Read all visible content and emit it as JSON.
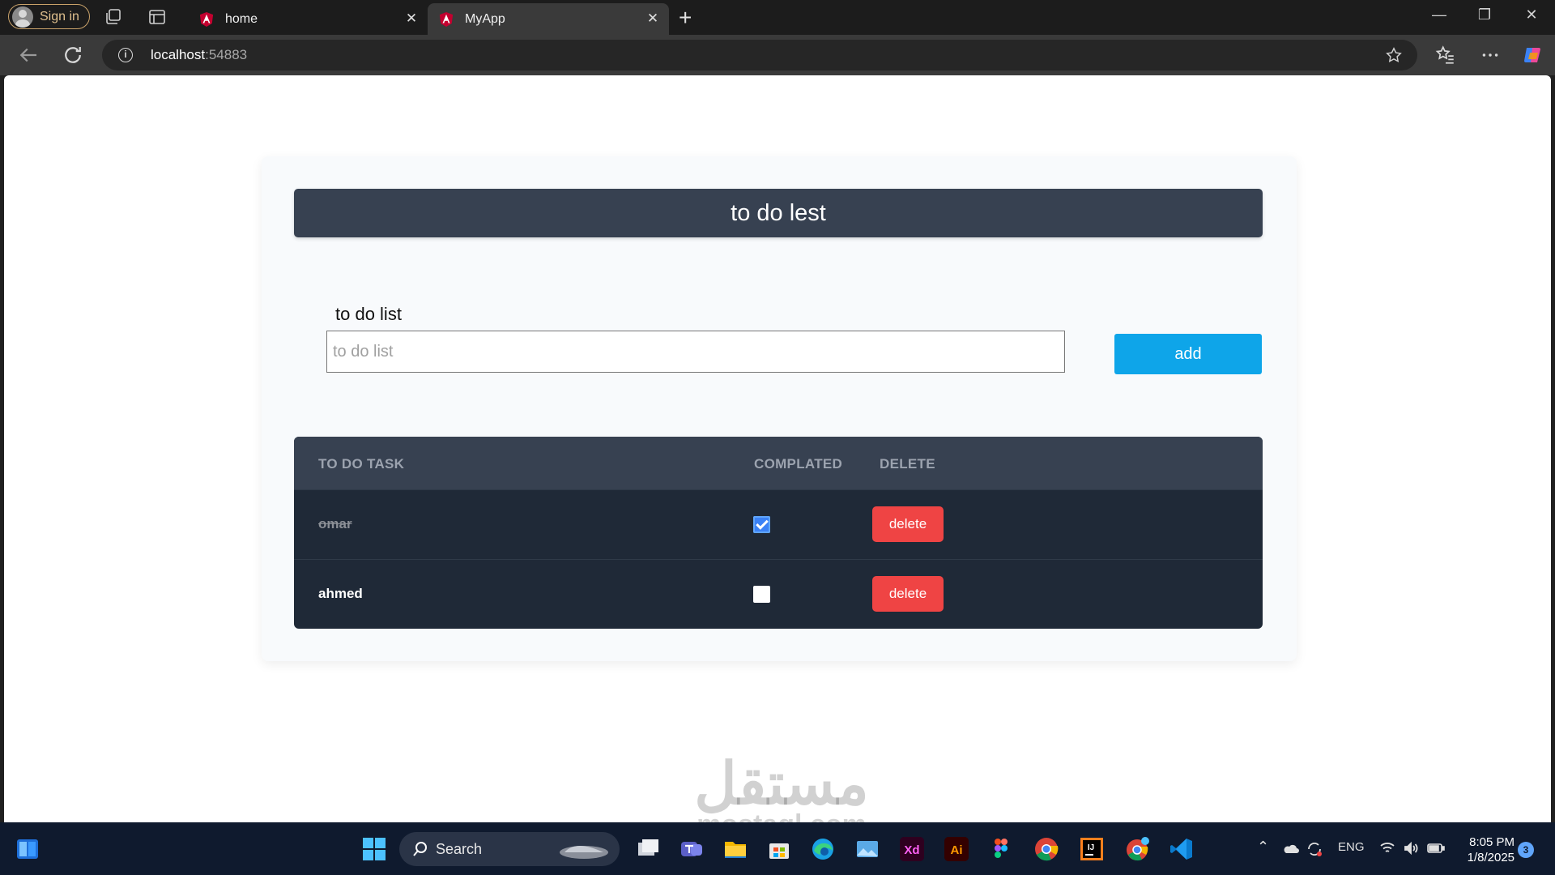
{
  "browser": {
    "signin_label": "Sign in",
    "tabs": [
      {
        "label": "home",
        "active": false
      },
      {
        "label": "MyApp",
        "active": true
      }
    ],
    "url_host": "localhost",
    "url_port": ":54883"
  },
  "app": {
    "header_title": "to do lest",
    "input_label": "to do list",
    "input_placeholder": "to do list",
    "input_value": "",
    "add_label": "add",
    "table": {
      "columns": [
        "TO DO TASK",
        "COMPLATED",
        "DELETE"
      ],
      "rows": [
        {
          "task": "omar",
          "completed": true,
          "delete_label": "delete"
        },
        {
          "task": "ahmed",
          "completed": false,
          "delete_label": "delete"
        }
      ]
    }
  },
  "watermark": {
    "text": "مستقل",
    "sub": "mostaql.com"
  },
  "taskbar": {
    "search_label": "Search",
    "language": "ENG",
    "time": "8:05 PM",
    "date": "1/8/2025",
    "notification_count": "3",
    "apps": [
      "file-explorer-icon",
      "edge-icon",
      "xd-icon",
      "illustrator-icon",
      "figma-icon",
      "chrome-icon",
      "vscode-icon"
    ]
  },
  "colors": {
    "header_bg": "#374151",
    "table_bg": "#1f2937",
    "add_button": "#0ea5e9",
    "delete_button": "#ef4444"
  }
}
